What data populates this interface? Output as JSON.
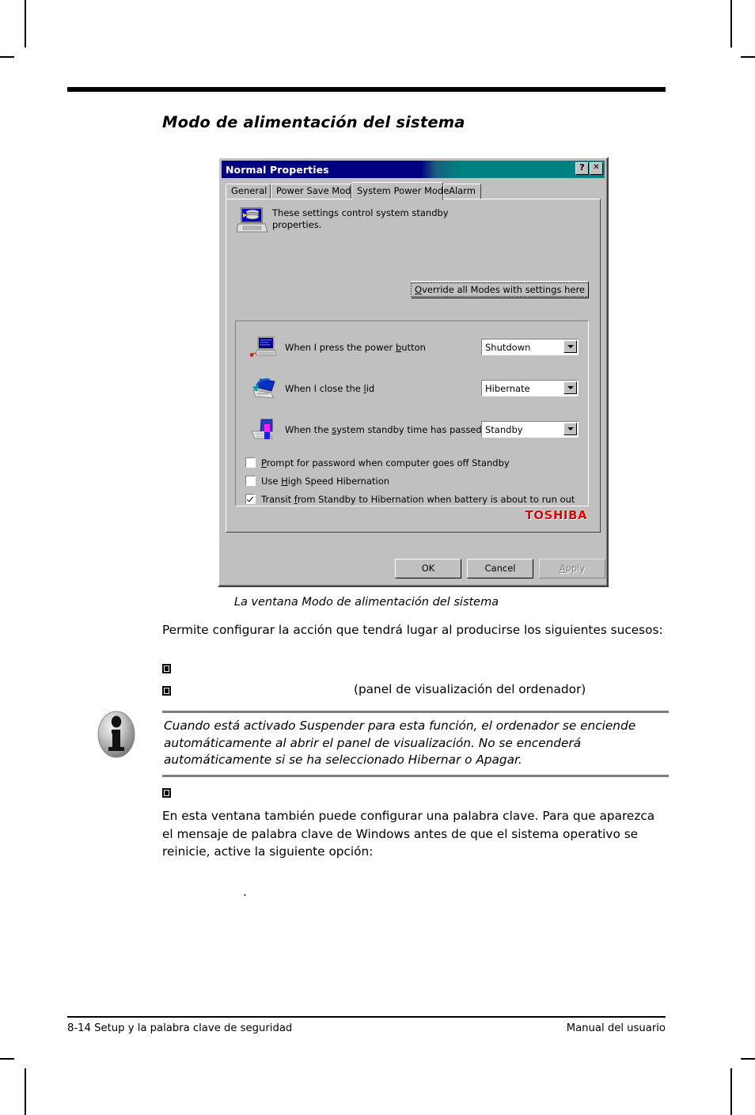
{
  "page": {
    "section_title": "Modo de alimentación del sistema",
    "caption": "La ventana Modo de alimentación del sistema",
    "paragraph_1": "Permite configurar la acción que tendrá lugar al producirse los siguientes sucesos:",
    "bullet_2_trailing_text": "(panel de visualización del ordenador)",
    "paragraph_2": "En esta ventana también puede configurar una palabra clave. Para que aparezca el mensaje de palabra clave de Windows antes de que el sistema operativo se reinicie, active la siguiente opción:",
    "trailing_period": "."
  },
  "note": {
    "icon": "info-icon",
    "text": "Cuando está activado Suspender para esta función, el ordenador se enciende automáticamente al abrir el panel de visualización. No se encenderá automáticamente si se ha seleccionado Hibernar o Apagar."
  },
  "footer": {
    "left": "8-14  Setup y la palabra clave de seguridad",
    "right": "Manual del usuario"
  },
  "dialog": {
    "title": "Normal Properties",
    "titlebar_colors": {
      "left": "#000080",
      "right": "#008080"
    },
    "help_button": "?",
    "close_button": "✕",
    "tabs": [
      {
        "label": "General",
        "active": false
      },
      {
        "label": "Power Save Mode",
        "active": false
      },
      {
        "label": "System Power Mode",
        "active": true
      },
      {
        "label": "Alarm",
        "active": false
      }
    ],
    "description": "These settings control system standby properties.",
    "description_icon": "laptop-disk-icon",
    "override_button": {
      "accel": "O",
      "rest": "verride all Modes with settings here"
    },
    "options": [
      {
        "icon": "desktop-power-button-icon",
        "label_pre": "When I press the power ",
        "label_accel": "b",
        "label_post": "utton",
        "value": "Shutdown"
      },
      {
        "icon": "laptop-close-lid-icon",
        "label_pre": "When I close the ",
        "label_accel": "l",
        "label_post": "id",
        "value": "Hibernate"
      },
      {
        "icon": "laptop-standby-icon",
        "label_pre": "When the ",
        "label_accel": "s",
        "label_post": "ystem standby time has passed",
        "value": "Standby"
      }
    ],
    "checkboxes": [
      {
        "checked": false,
        "label_pre": "",
        "label_accel": "P",
        "label_post": "rompt for password when computer goes off Standby"
      },
      {
        "checked": false,
        "label_pre": "Use ",
        "label_accel": "H",
        "label_post": "igh Speed Hibernation"
      },
      {
        "checked": true,
        "label_pre": "Transit ",
        "label_accel": "f",
        "label_post": "rom Standby to Hibernation when battery is about to run out"
      }
    ],
    "brand": "TOSHIBA",
    "brand_color": "#e00000",
    "buttons": [
      {
        "label": "OK",
        "disabled": false
      },
      {
        "label": "Cancel",
        "disabled": false
      },
      {
        "label": "Apply",
        "disabled": true,
        "accel": "A",
        "rest": "pply"
      }
    ]
  }
}
